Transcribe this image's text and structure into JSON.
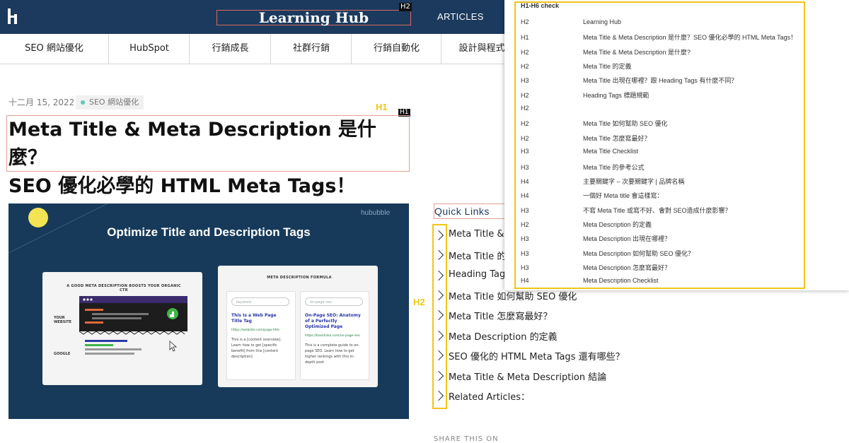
{
  "header": {
    "site_title": "Learning Hub",
    "overlay_tag": "H2",
    "nav_articles": "ARTICLES"
  },
  "categories": [
    "SEO 網站優化",
    "HubSpot",
    "行銷成長",
    "社群行銷",
    "行銷自動化",
    "設計與程式"
  ],
  "post": {
    "date": "十二月 15, 2022",
    "category": "SEO 網站優化",
    "h1_label": "H1",
    "h1_tag": "H1",
    "title": "Meta Title & Meta Description 是什麼？\nSEO 優化必學的 HTML Meta Tags！"
  },
  "hero": {
    "brand": "hububble",
    "title": "Optimize Title and Description Tags",
    "card1": {
      "caption": "A GOOD META DESCRIPTION BOOSTS YOUR ORGANIC CTR",
      "label_website": "YOUR WEBSITE",
      "label_google": "GOOGLE"
    },
    "card2": {
      "caption": "META DESCRIPTION FORMULA",
      "left": {
        "search": "keyword",
        "title": "This Is a Web Page Title Tag",
        "url": "https://website.com/page-title",
        "desc": "This is a [content overview]. Learn how to get [specific benefit] from this [content description]"
      },
      "right": {
        "search": "on-page seo",
        "title": "On-Page SEO: Anatomy of a Perfectly Optimized Page",
        "url": "https://backlinko.com/on-page-seo",
        "desc": "This is a complete guide to on-page SEO. Learn how to get higher rankings with this in-depth post"
      }
    }
  },
  "quick_links": {
    "title": "Quick Links",
    "h2_label": "H2",
    "items": [
      "Meta Title & M",
      "Meta Title 的定",
      "Heading Tags",
      "Meta Title 如何幫助 SEO 優化",
      "Meta Title 怎麼寫最好？",
      "Meta Description 的定義",
      "SEO 優化的 HTML Meta Tags 還有哪些？",
      "Meta Title & Meta Description 結論",
      "Related Articles："
    ]
  },
  "share": "SHARE THIS ON",
  "check_panel": {
    "title": "H1-H6 check",
    "rows": [
      {
        "level": "H2",
        "text": "Learning Hub"
      },
      {
        "level": "H1",
        "text": "Meta Title & Meta Description 是什麼？SEO 優化必學的 HTML Meta Tags！"
      },
      {
        "level": "H2",
        "text": "Meta Title & Meta Description 是什麼?"
      },
      {
        "level": "H2",
        "text": "Meta Title 的定義"
      },
      {
        "level": "H3",
        "text": "Meta Title 出現在哪裡？跟 Heading Tags 有什麼不同？"
      },
      {
        "level": "H2",
        "text": "Heading Tags 標題規範"
      },
      {
        "level": "H2",
        "text": ""
      },
      {
        "level": "H2",
        "text": "Meta Title 如何幫助 SEO 優化"
      },
      {
        "level": "H2",
        "text": "Meta Title 怎麼寫最好？"
      },
      {
        "level": "H3",
        "text": "Meta Title Checklist"
      },
      {
        "level": "H3",
        "text": "Meta Title 的參考公式"
      },
      {
        "level": "H4",
        "text": "主要關鍵字 – 次要關鍵字 | 品牌名稱"
      },
      {
        "level": "H4",
        "text": "一個好 Meta title 會這樣寫："
      },
      {
        "level": "H3",
        "text": "不寫 Meta Title 或寫不好、會對 SEO造成什麼影響？"
      },
      {
        "level": "H2",
        "text": "Meta Description 的定義"
      },
      {
        "level": "H3",
        "text": "Meta Description 出現在哪裡？"
      },
      {
        "level": "H3",
        "text": "Meta Description 如何幫助 SEO 優化？"
      },
      {
        "level": "H3",
        "text": "Meta Description 怎麼寫最好？"
      },
      {
        "level": "H4",
        "text": "Meta Description Checklist"
      }
    ]
  },
  "colors": {
    "header_bg": "#1b3a5e",
    "highlight_yellow": "#f2c418",
    "outline_red": "#d9695b",
    "category_dot": "#5ec9b5"
  }
}
